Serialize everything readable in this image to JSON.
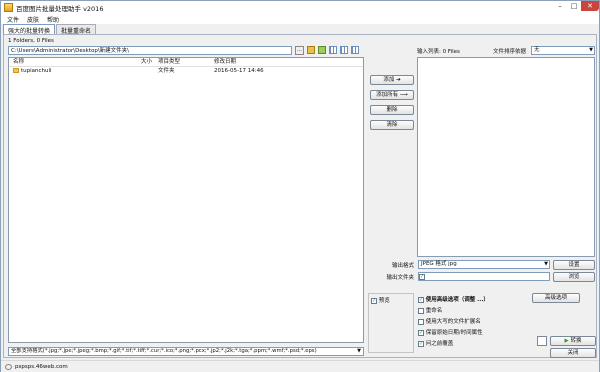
{
  "app": {
    "title": "百度图片批量处理助手  v2016"
  },
  "menu": [
    "文件",
    "皮肤",
    "帮助"
  ],
  "tabs": [
    "强大的批量转换",
    "批量重命名"
  ],
  "left": {
    "folder_info": "1 Folders, 0 Files",
    "path": "C:\\Users\\Administrator\\Desktop\\新建文件夹\\",
    "browse_label": "...",
    "columns": {
      "name": "名称",
      "size": "大小",
      "type": "项目类型",
      "date": "修改日期"
    },
    "rows": [
      {
        "name": "tupianchuli",
        "size": "",
        "type": "文件夹",
        "date": "2016-05-17 14:46"
      }
    ],
    "filter": "全部支持格式(*.jpg;*.jpe;*.jpeg;*.bmp;*.gif;*.tif;*.tiff;*.cur;*.ico;*.png;*.pcx;*.jp2;*.j2k;*.tga;*.ppm;*.wmf;*.psd;*.eps)"
  },
  "middle": {
    "add": "添加",
    "add_all": "添加所有",
    "delete": "删除",
    "clear": "清除"
  },
  "right": {
    "input_list_label": "输入列表: 0 Files",
    "sort_label": "文件排序依据",
    "sort_value": "无",
    "output_format_label": "输出格式",
    "output_format_value": "JPEG 格式 jpg",
    "settings": "设置",
    "output_folder_label": "输出文件夹",
    "browse": "浏览",
    "preview": "预览",
    "advanced_label": "使用高级选项（调整 ...）",
    "advanced_btn": "高级选项",
    "rename": "重命名",
    "uppercase_ext": "使用大写的文件扩展名",
    "keep_date": "保留原始日期/时间属性",
    "overwrite": "问之前覆盖",
    "convert": "转换",
    "close": "关闭"
  },
  "status": {
    "text": "pspsps.46web.com"
  }
}
